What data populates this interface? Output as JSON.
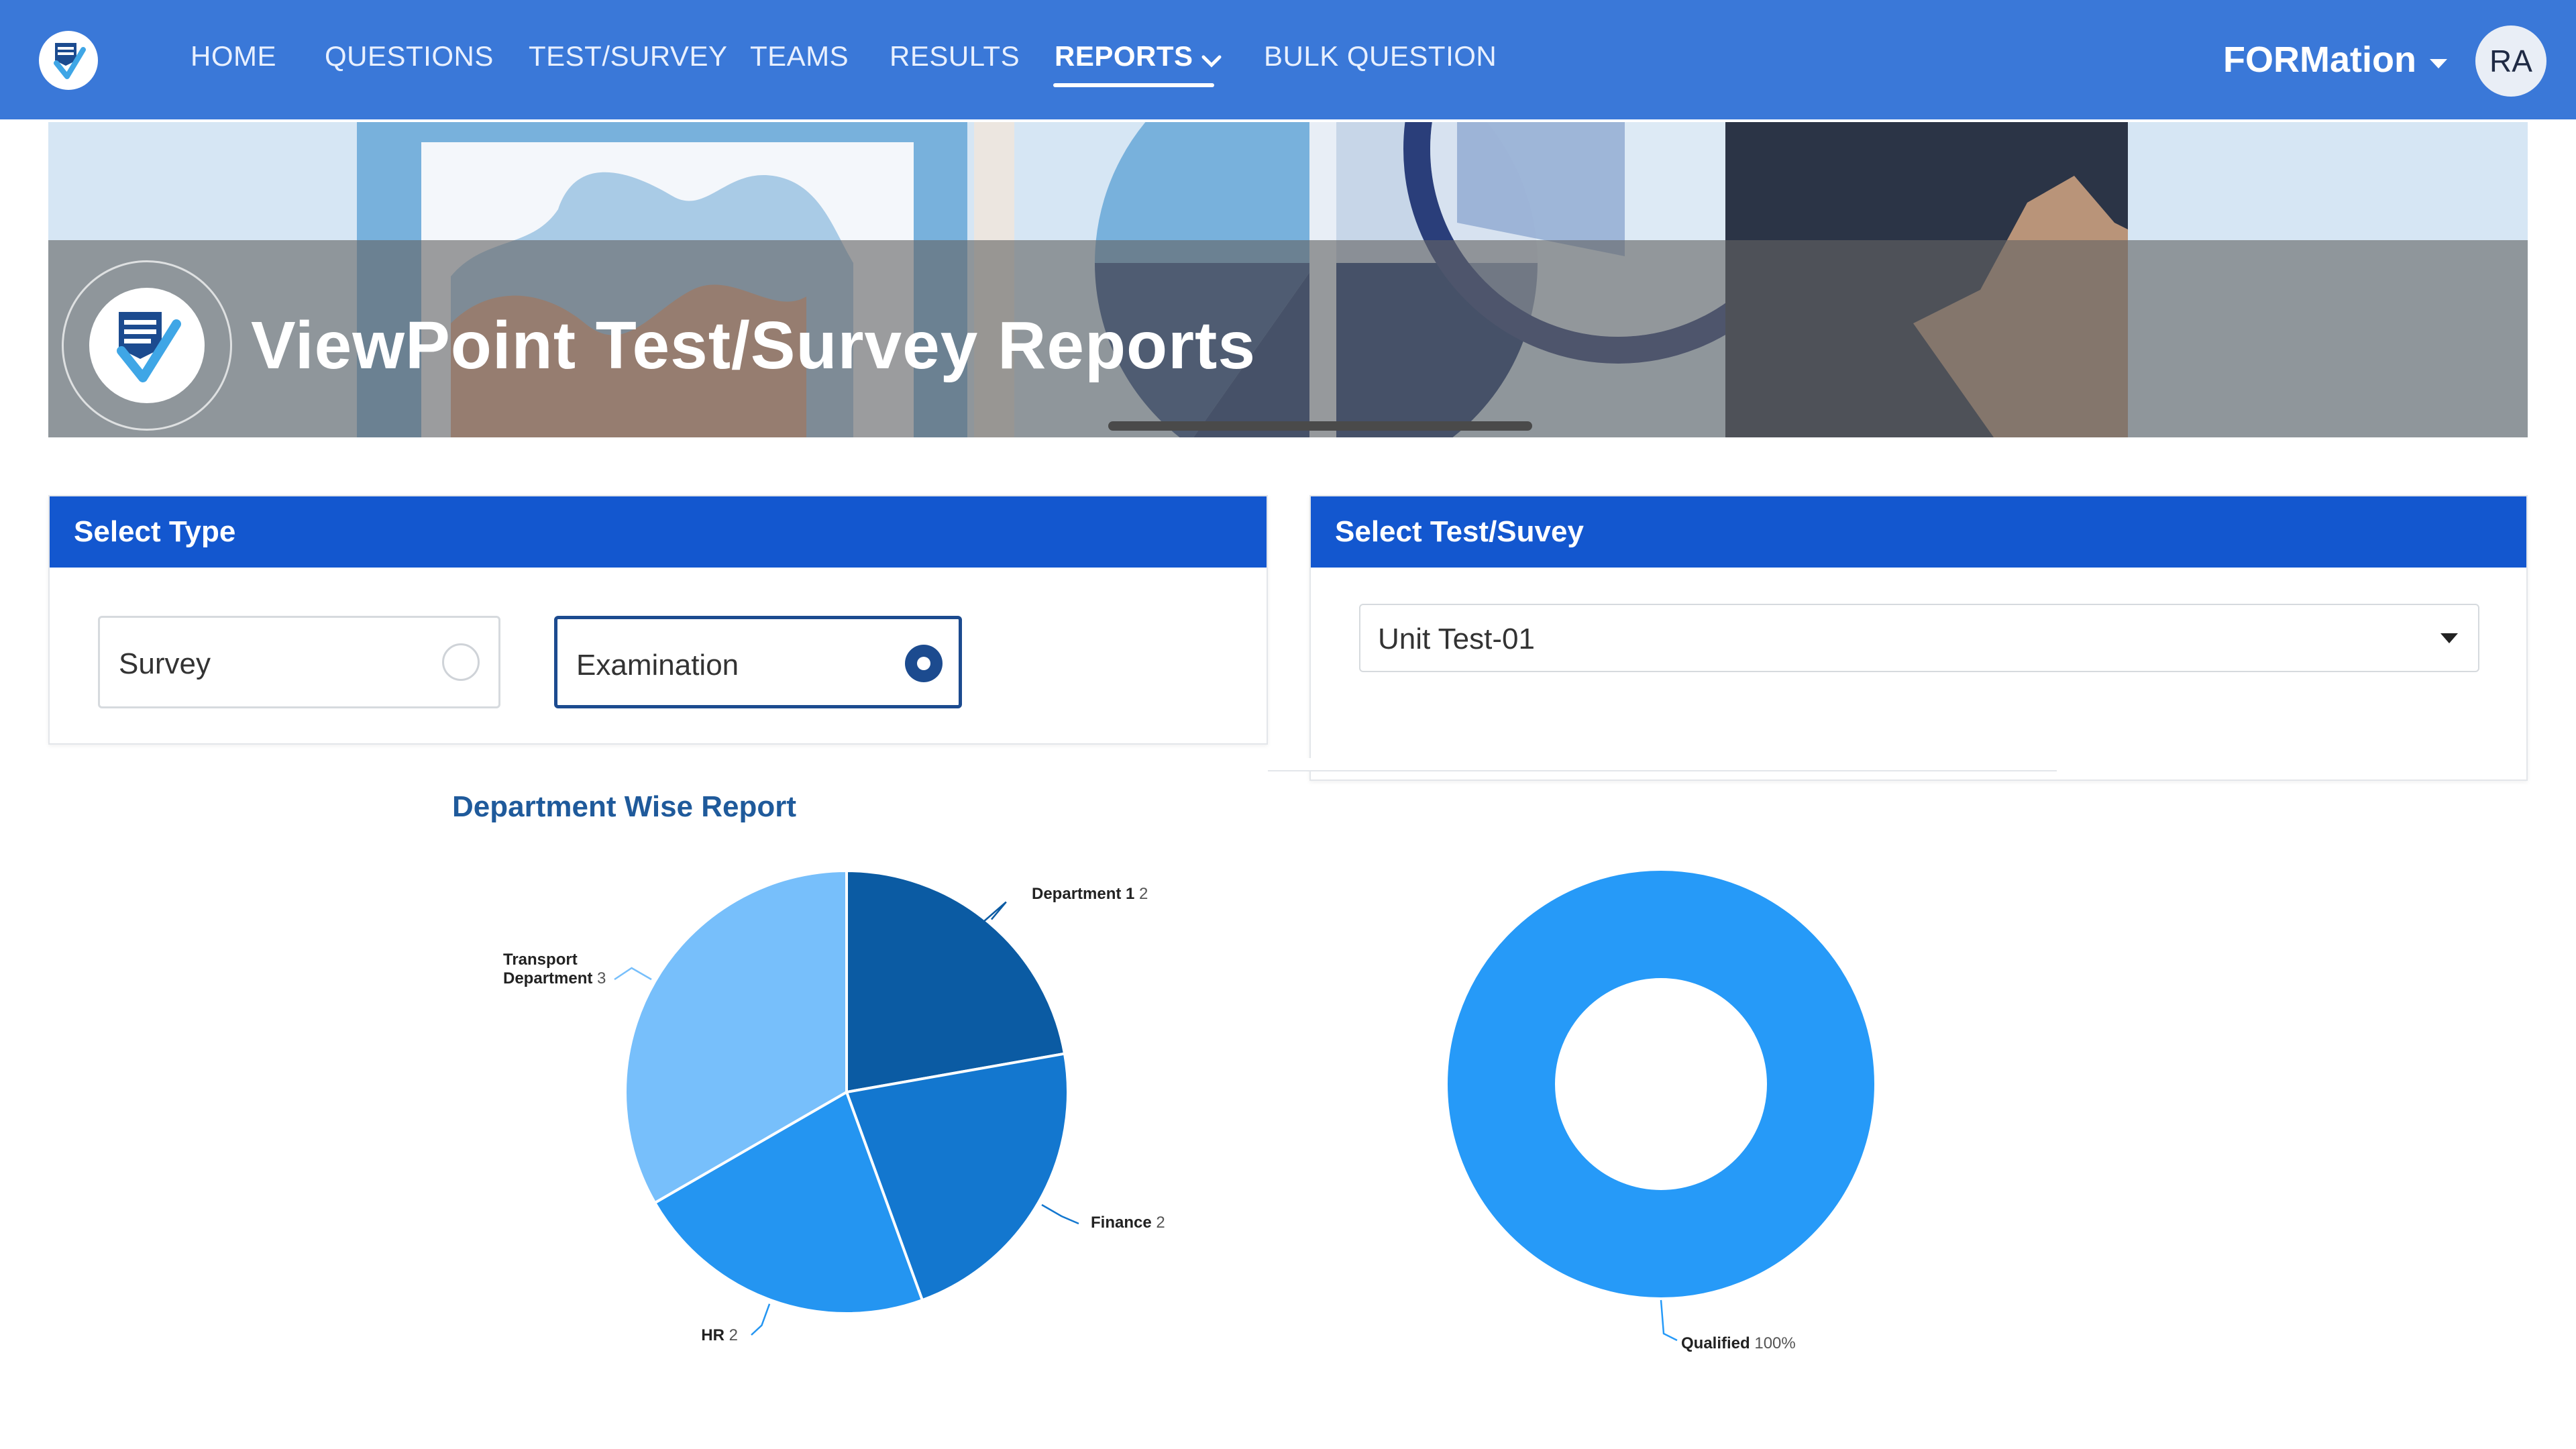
{
  "nav": {
    "items": [
      {
        "label": "HOME"
      },
      {
        "label": "QUESTIONS"
      },
      {
        "label": "TEST/SURVEY"
      },
      {
        "label": "TEAMS"
      },
      {
        "label": "RESULTS"
      },
      {
        "label": "REPORTS",
        "active": true
      },
      {
        "label": "BULK QUESTION"
      }
    ],
    "brand": "FORMation",
    "avatar_initials": "RA"
  },
  "banner": {
    "title": "ViewPoint Test/Survey Reports"
  },
  "select_type": {
    "header": "Select Type",
    "options": [
      {
        "label": "Survey",
        "selected": false
      },
      {
        "label": "Examination",
        "selected": true
      }
    ]
  },
  "select_test": {
    "header": "Select Test/Suvey",
    "value": "Unit Test-01"
  },
  "colors": {
    "nav_bg": "#3a78d8",
    "panel_header": "#1357cf",
    "selected_radio": "#1c4b8f",
    "chart_title": "#1f5a9b"
  },
  "chart_data": [
    {
      "type": "pie",
      "title": "Department Wise Report",
      "categories": [
        "Department 1",
        "Finance",
        "HR",
        "Transport Department"
      ],
      "values": [
        2,
        2,
        2,
        3
      ],
      "colors": [
        "#0b5ba3",
        "#1377cf",
        "#2495f1",
        "#77bffb"
      ]
    },
    {
      "type": "pie",
      "title": "",
      "donut": true,
      "categories": [
        "Qualified"
      ],
      "values": [
        100
      ],
      "value_labels": [
        "100%"
      ],
      "colors": [
        "#269af8"
      ]
    }
  ]
}
